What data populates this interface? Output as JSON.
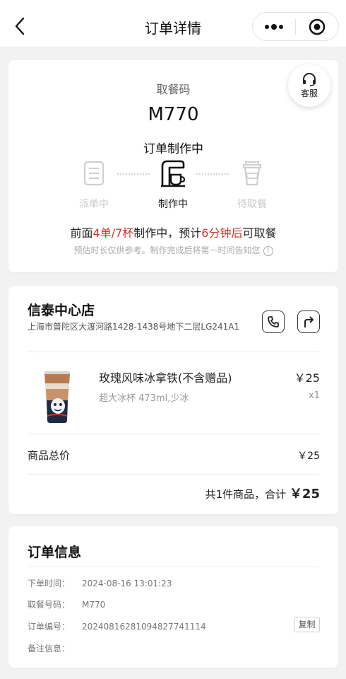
{
  "nav": {
    "title": "订单详情",
    "back_icon": "chevron-left-icon",
    "more_icon": "more-dots-icon",
    "close_icon": "target-circle-icon"
  },
  "status_card": {
    "pickup_label": "取餐码",
    "pickup_code": "M770",
    "status_title": "订单制作中",
    "service_label": "客服",
    "steps": [
      {
        "label": "派单中",
        "icon": "clipboard-list-icon",
        "state": "inactive"
      },
      {
        "label": "制作中",
        "icon": "coffee-machine-icon",
        "state": "active"
      },
      {
        "label": "待取餐",
        "icon": "takeaway-cup-icon",
        "state": "inactive"
      }
    ],
    "progress": {
      "p1": "前面",
      "p2": "4单/7杯",
      "p3": "制作中，预计",
      "p4": "6分钟后",
      "p5": "可取餐"
    },
    "hint": "预估时长仅供参考。制作完成后将第一时间告知您",
    "highlight_color": "#c53a2f"
  },
  "store_card": {
    "name": "信泰中心店",
    "address": "上海市普陀区大渡河路1428-1438号地下二层LG241A1",
    "product": {
      "name": "玫瑰风味冰拿铁(不含赠品)",
      "spec": "超大冰杯 473ml,少冰",
      "price": "￥25",
      "qty": "x1"
    },
    "total_label": "商品总价",
    "total_value": "￥25",
    "summary_prefix": "共1件商品，合计",
    "summary_total": "￥25"
  },
  "info_card": {
    "title": "订单信息",
    "rows": [
      {
        "key": "下单时间：",
        "value": "2024-08-16 13:01:23"
      },
      {
        "key": "取餐号码：",
        "value": "M770"
      },
      {
        "key": "订单编号：",
        "value": "20240816281094827741114"
      },
      {
        "key": "备注信息：",
        "value": ""
      }
    ],
    "copy_label": "复制"
  }
}
